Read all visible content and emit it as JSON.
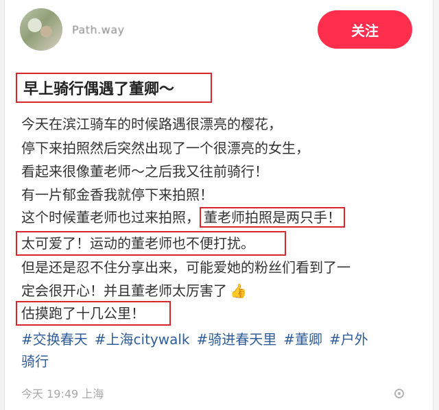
{
  "header": {
    "username": "Path.way",
    "follow_label": "关注"
  },
  "post": {
    "title": "早上骑行偶遇了董卿～",
    "lines": [
      "今天在滨江骑车的时候路遇很漂亮的樱花，",
      "停下来拍照然后突然出现了一个很漂亮的女生，",
      "看起来很像董老师～之后我又往前骑行！",
      "有一片郁金香我就停下来拍照！"
    ],
    "line5_plain": "这个时候董老师也过来拍照，",
    "line5_highlight": "董老师拍照是两只手！",
    "line6_highlight": "太可爱了！运动的董老师也不便打扰。",
    "line7": "但是还是忍不住分享出来，可能爱她的粉丝们看到了一",
    "line8": "定会很开心！并且董老师太厉害了",
    "line8_emoji": "👍",
    "line9_highlight": "估摸跑了十几公里！",
    "tags": [
      "#交换春天",
      "#上海citywalk",
      "#骑进春天里",
      "#董卿",
      "#户外"
    ],
    "tags_wrap": "骑行",
    "meta": "今天 19:49 上海"
  },
  "colors": {
    "follow_bg": "#ff2e4d",
    "highlight_border": "#d9262c",
    "tag_color": "#2f5d9a"
  }
}
